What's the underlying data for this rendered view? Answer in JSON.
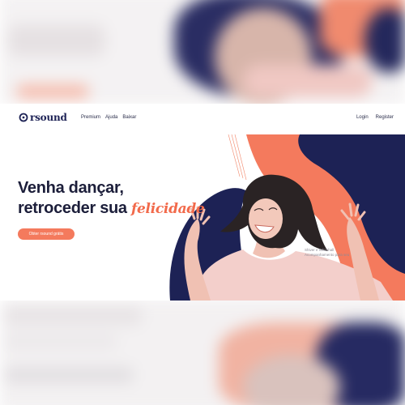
{
  "brand": {
    "name": "rsound"
  },
  "nav": {
    "links": [
      "Premium",
      "Ajuda",
      "Baixar"
    ],
    "login": "Login",
    "register": "Register"
  },
  "hero": {
    "line1": "Venha dançar,",
    "line2": "retroceder sua",
    "accent": "felicidade",
    "cta": "Obter rsound grátis"
  },
  "caption": {
    "line1": "Shiver e Whitehall",
    "line2": "Acompanhamento para seu"
  },
  "colors": {
    "navy": "#1d2255",
    "coral": "#f47a5d",
    "text": "#1c1e3a",
    "white": "#ffffff"
  },
  "icons": {
    "logo": "ring-logo-icon"
  }
}
